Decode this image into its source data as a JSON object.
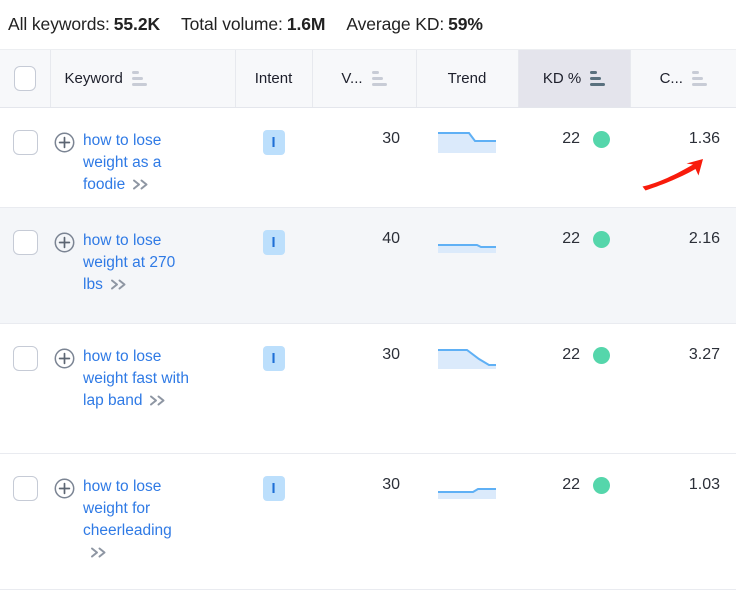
{
  "summary": {
    "stats": [
      {
        "label": "All keywords:",
        "value": "55.2K"
      },
      {
        "label": "Total volume:",
        "value": "1.6M"
      },
      {
        "label": "Average KD:",
        "value": "59%"
      }
    ]
  },
  "table": {
    "columns": [
      {
        "key": "select",
        "label": "",
        "sortable": false,
        "sort_active": false
      },
      {
        "key": "keyword",
        "label": "Keyword",
        "sortable": true,
        "sort_active": false
      },
      {
        "key": "intent",
        "label": "Intent",
        "sortable": false,
        "sort_active": false
      },
      {
        "key": "volume",
        "label": "V...",
        "sortable": true,
        "sort_active": false
      },
      {
        "key": "trend",
        "label": "Trend",
        "sortable": false,
        "sort_active": false
      },
      {
        "key": "kd",
        "label": "KD %",
        "sortable": true,
        "sort_active": true
      },
      {
        "key": "cpc",
        "label": "C...",
        "sortable": true,
        "sort_active": false
      }
    ],
    "rows": [
      {
        "keyword": "how to lose weight as a foodie",
        "intent": "I",
        "volume": "30",
        "kd": "22",
        "kd_color": "#55d6ab",
        "cpc": "1.36",
        "trend": "step-down-late"
      },
      {
        "keyword": "how to lose weight at 270 lbs",
        "intent": "I",
        "volume": "40",
        "kd": "22",
        "kd_color": "#55d6ab",
        "cpc": "2.16",
        "trend": "flat-small-step"
      },
      {
        "keyword": "how to lose weight fast with lap band",
        "intent": "I",
        "volume": "30",
        "kd": "22",
        "kd_color": "#55d6ab",
        "cpc": "3.27",
        "trend": "step-down-steep"
      },
      {
        "keyword": "how to lose weight for cheerleading",
        "intent": "I",
        "volume": "30",
        "kd": "22",
        "kd_color": "#55d6ab",
        "cpc": "1.03",
        "trend": "flat-step-up"
      }
    ]
  },
  "annotation": {
    "arrow_color": "#f81b0b",
    "points_at": "1.36"
  },
  "colors": {
    "link": "#2f7ae5",
    "intent_badge_bg": "#bcdffc",
    "intent_badge_fg": "#1f6fd6",
    "kd_dot": "#55d6ab",
    "spark_line": "#5fb0f5",
    "spark_fill": "#dbeafb",
    "header_bg": "#f7f8fa",
    "header_kd_bg": "#e4e4ec",
    "row_alt_bg": "#f4f6f9"
  }
}
